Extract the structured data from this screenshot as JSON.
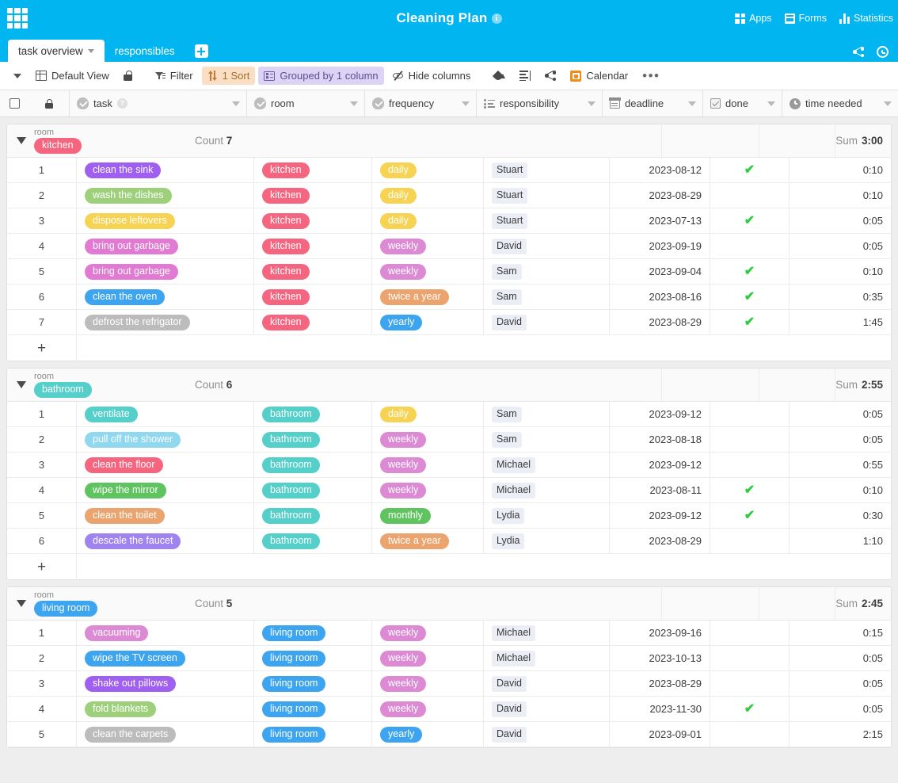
{
  "app": {
    "title": "Cleaning Plan",
    "info_icon": "info-icon",
    "apps_grid_icon": "apps-grid-icon",
    "top_right": [
      {
        "label": "Apps",
        "icon": "apps-icon"
      },
      {
        "label": "Forms",
        "icon": "forms-icon"
      },
      {
        "label": "Statistics",
        "icon": "statistics-icon"
      }
    ],
    "tabbar_right": [
      {
        "icon": "share-icon"
      },
      {
        "icon": "history-clock-icon"
      }
    ],
    "brand_color": "#00b5f0"
  },
  "tabs": [
    {
      "label": "task overview",
      "active": true
    },
    {
      "label": "responsibles",
      "active": false
    }
  ],
  "tab_add_label": "+",
  "toolbar": {
    "view_caret": "chevron-down-icon",
    "view_label": "Default View",
    "lock_icon": "lock-icon",
    "filter_label": "Filter",
    "sort_label": "1 Sort",
    "group_label": "Grouped by 1 column",
    "hide_columns_label": "Hide columns",
    "paint_icon": "paint-bucket-icon",
    "rowheight_icon": "row-height-icon",
    "share_icon": "share-icon",
    "calendar_label": "Calendar",
    "more_label": "•••",
    "sort_chip_color": "#fbdfc4",
    "group_chip_color": "#ddd4f5"
  },
  "columns": [
    {
      "key": "task",
      "label": "task",
      "icon": "select-type-icon",
      "help": true
    },
    {
      "key": "room",
      "label": "room",
      "icon": "select-type-icon"
    },
    {
      "key": "frequency",
      "label": "frequency",
      "icon": "select-type-icon"
    },
    {
      "key": "responsibility",
      "label": "responsibility",
      "icon": "list-type-icon"
    },
    {
      "key": "deadline",
      "label": "deadline",
      "icon": "calendar-icon"
    },
    {
      "key": "done",
      "label": "done",
      "icon": "checkbox-icon"
    },
    {
      "key": "time_needed",
      "label": "time needed",
      "icon": "clock-icon"
    }
  ],
  "labels": {
    "count": "Count",
    "sum": "Sum",
    "group_column_name": "room",
    "add_row": "+"
  },
  "groups": [
    {
      "name": "kitchen",
      "color": "#f5657f",
      "count": "7",
      "sum": "3:00",
      "rows": [
        {
          "n": "1",
          "task": "clean the sink",
          "task_color": "#9f5ff0",
          "room": "kitchen",
          "room_color": "#f5657f",
          "frequency": "daily",
          "frequency_color": "#f7d354",
          "responsibility": "Stuart",
          "deadline": "2023-08-12",
          "done": true,
          "time": "0:10"
        },
        {
          "n": "2",
          "task": "wash the dishes",
          "task_color": "#9ed07c",
          "room": "kitchen",
          "room_color": "#f5657f",
          "frequency": "daily",
          "frequency_color": "#f7d354",
          "responsibility": "Stuart",
          "deadline": "2023-08-29",
          "done": false,
          "time": "0:10"
        },
        {
          "n": "3",
          "task": "dispose leftovers",
          "task_color": "#f7d354",
          "room": "kitchen",
          "room_color": "#f5657f",
          "frequency": "daily",
          "frequency_color": "#f7d354",
          "responsibility": "Stuart",
          "deadline": "2023-07-13",
          "done": true,
          "time": "0:05"
        },
        {
          "n": "4",
          "task": "bring out garbage",
          "task_color": "#e07ad2",
          "room": "kitchen",
          "room_color": "#f5657f",
          "frequency": "weekly",
          "frequency_color": "#dd8ad5",
          "responsibility": "David",
          "deadline": "2023-09-19",
          "done": false,
          "time": "0:05"
        },
        {
          "n": "5",
          "task": "bring out garbage",
          "task_color": "#e07ad2",
          "room": "kitchen",
          "room_color": "#f5657f",
          "frequency": "weekly",
          "frequency_color": "#dd8ad5",
          "responsibility": "Sam",
          "deadline": "2023-09-04",
          "done": true,
          "time": "0:10"
        },
        {
          "n": "6",
          "task": "clean the oven",
          "task_color": "#3da5f0",
          "room": "kitchen",
          "room_color": "#f5657f",
          "frequency": "twice a year",
          "frequency_color": "#eba46d",
          "responsibility": "Sam",
          "deadline": "2023-08-16",
          "done": true,
          "time": "0:35"
        },
        {
          "n": "7",
          "task": "defrost the refrigator",
          "task_color": "#bcbcbc",
          "room": "kitchen",
          "room_color": "#f5657f",
          "frequency": "yearly",
          "frequency_color": "#3da5f0",
          "responsibility": "David",
          "deadline": "2023-08-29",
          "done": true,
          "time": "1:45"
        }
      ]
    },
    {
      "name": "bathroom",
      "color": "#54cfca",
      "count": "6",
      "sum": "2:55",
      "rows": [
        {
          "n": "1",
          "task": "ventilate",
          "task_color": "#54cfca",
          "room": "bathroom",
          "room_color": "#54cfca",
          "frequency": "daily",
          "frequency_color": "#f7d354",
          "responsibility": "Sam",
          "deadline": "2023-09-12",
          "done": false,
          "time": "0:05"
        },
        {
          "n": "2",
          "task": "pull off the shower",
          "task_color": "#8fd8ef",
          "room": "bathroom",
          "room_color": "#54cfca",
          "frequency": "weekly",
          "frequency_color": "#dd8ad5",
          "responsibility": "Sam",
          "deadline": "2023-08-18",
          "done": false,
          "time": "0:05"
        },
        {
          "n": "3",
          "task": "clean the floor",
          "task_color": "#f5657f",
          "room": "bathroom",
          "room_color": "#54cfca",
          "frequency": "weekly",
          "frequency_color": "#dd8ad5",
          "responsibility": "Michael",
          "deadline": "2023-09-12",
          "done": false,
          "time": "0:55"
        },
        {
          "n": "4",
          "task": "wipe the mirror",
          "task_color": "#5fc45f",
          "room": "bathroom",
          "room_color": "#54cfca",
          "frequency": "weekly",
          "frequency_color": "#dd8ad5",
          "responsibility": "Michael",
          "deadline": "2023-08-11",
          "done": true,
          "time": "0:10"
        },
        {
          "n": "5",
          "task": "clean the toilet",
          "task_color": "#eba46d",
          "room": "bathroom",
          "room_color": "#54cfca",
          "frequency": "monthly",
          "frequency_color": "#5fc45f",
          "responsibility": "Lydia",
          "deadline": "2023-09-12",
          "done": true,
          "time": "0:30"
        },
        {
          "n": "6",
          "task": "descale the faucet",
          "task_color": "#9f84f0",
          "room": "bathroom",
          "room_color": "#54cfca",
          "frequency": "twice a year",
          "frequency_color": "#eba46d",
          "responsibility": "Lydia",
          "deadline": "2023-08-29",
          "done": false,
          "time": "1:10"
        }
      ]
    },
    {
      "name": "living room",
      "color": "#3da5f0",
      "count": "5",
      "sum": "2:45",
      "rows": [
        {
          "n": "1",
          "task": "vacuuming",
          "task_color": "#dd8ad5",
          "room": "living room",
          "room_color": "#3da5f0",
          "frequency": "weekly",
          "frequency_color": "#dd8ad5",
          "responsibility": "Michael",
          "deadline": "2023-09-16",
          "done": false,
          "time": "0:15"
        },
        {
          "n": "2",
          "task": "wipe the TV screen",
          "task_color": "#3da5f0",
          "room": "living room",
          "room_color": "#3da5f0",
          "frequency": "weekly",
          "frequency_color": "#dd8ad5",
          "responsibility": "Michael",
          "deadline": "2023-10-13",
          "done": false,
          "time": "0:05"
        },
        {
          "n": "3",
          "task": "shake out pillows",
          "task_color": "#9f5ff0",
          "room": "living room",
          "room_color": "#3da5f0",
          "frequency": "weekly",
          "frequency_color": "#dd8ad5",
          "responsibility": "David",
          "deadline": "2023-08-29",
          "done": false,
          "time": "0:05"
        },
        {
          "n": "4",
          "task": "fold blankets",
          "task_color": "#9ed07c",
          "room": "living room",
          "room_color": "#3da5f0",
          "frequency": "weekly",
          "frequency_color": "#dd8ad5",
          "responsibility": "David",
          "deadline": "2023-11-30",
          "done": true,
          "time": "0:05"
        },
        {
          "n": "5",
          "task": "clean the carpets",
          "task_color": "#bcbcbc",
          "room": "living room",
          "room_color": "#3da5f0",
          "frequency": "yearly",
          "frequency_color": "#3da5f0",
          "responsibility": "David",
          "deadline": "2023-09-01",
          "done": false,
          "time": "2:15"
        }
      ]
    }
  ]
}
